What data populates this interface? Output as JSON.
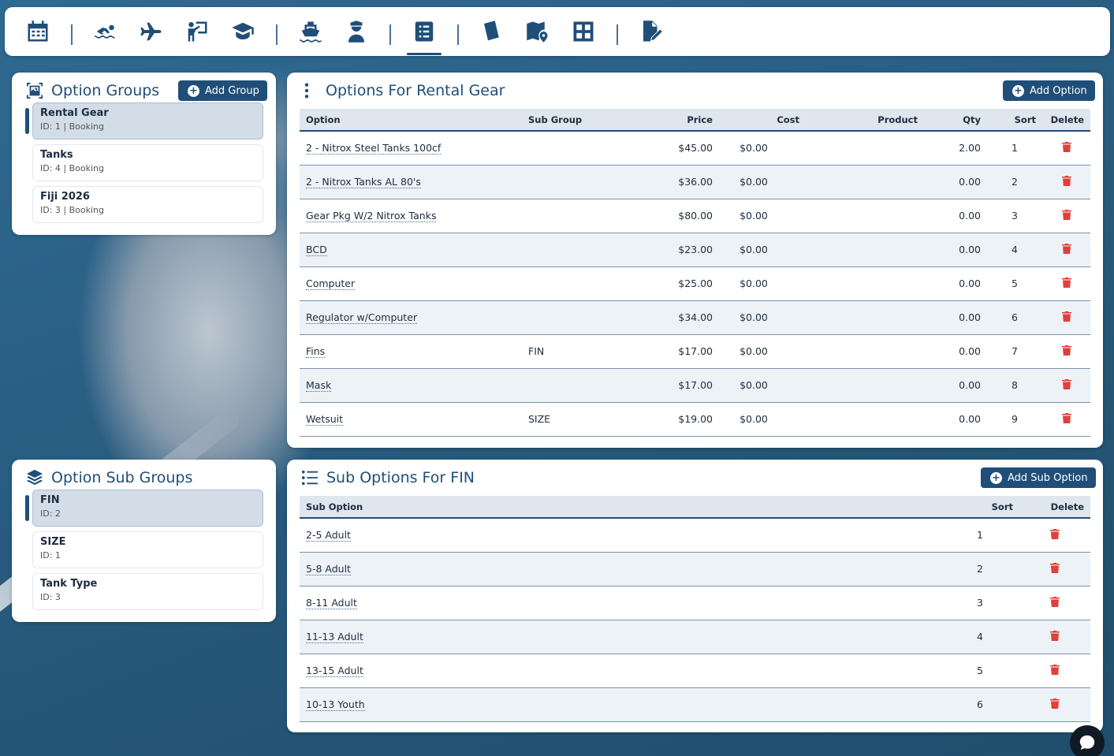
{
  "colors": {
    "accent": "#1f4e79",
    "delete": "#e0403a",
    "row_alt": "#edf2f7",
    "header_bg": "#dfe6ee"
  },
  "topnav": {
    "icons": [
      "calendar-icon",
      "swimmer-icon",
      "plane-icon",
      "instructor-icon",
      "graduation-cap-icon",
      "ship-icon",
      "captain-icon",
      "checklist-icon",
      "tablet-icon",
      "map-location-icon",
      "grid-icon",
      "file-signature-icon"
    ],
    "active": "checklist-icon"
  },
  "option_groups": {
    "title": "Option Groups",
    "add_label": "Add Group",
    "items": [
      {
        "name": "Rental Gear",
        "meta": "ID: 1 | Booking",
        "selected": true
      },
      {
        "name": "Tanks",
        "meta": "ID: 4 | Booking",
        "selected": false
      },
      {
        "name": "Fiji 2026",
        "meta": "ID: 3 | Booking",
        "selected": false
      }
    ]
  },
  "option_sub_groups": {
    "title": "Option Sub Groups",
    "items": [
      {
        "name": "FIN",
        "meta": "ID: 2",
        "selected": true
      },
      {
        "name": "SIZE",
        "meta": "ID: 1",
        "selected": false
      },
      {
        "name": "Tank Type",
        "meta": "ID: 3",
        "selected": false
      }
    ]
  },
  "options": {
    "title": "Options For Rental Gear",
    "add_label": "Add Option",
    "columns": [
      "Option",
      "Sub Group",
      "Price",
      "Cost",
      "Product",
      "Qty",
      "Sort",
      "Delete"
    ],
    "rows": [
      {
        "option": "2 - Nitrox Steel Tanks 100cf",
        "sub_group": "",
        "price": "$45.00",
        "cost": "$0.00",
        "product": "",
        "qty": "2.00",
        "sort": "1"
      },
      {
        "option": "2 - Nitrox Tanks AL 80's",
        "sub_group": "",
        "price": "$36.00",
        "cost": "$0.00",
        "product": "",
        "qty": "0.00",
        "sort": "2"
      },
      {
        "option": "Gear Pkg W/2 Nitrox Tanks",
        "sub_group": "",
        "price": "$80.00",
        "cost": "$0.00",
        "product": "",
        "qty": "0.00",
        "sort": "3"
      },
      {
        "option": "BCD",
        "sub_group": "",
        "price": "$23.00",
        "cost": "$0.00",
        "product": "",
        "qty": "0.00",
        "sort": "4"
      },
      {
        "option": "Computer",
        "sub_group": "",
        "price": "$25.00",
        "cost": "$0.00",
        "product": "",
        "qty": "0.00",
        "sort": "5"
      },
      {
        "option": "Regulator w/Computer",
        "sub_group": "",
        "price": "$34.00",
        "cost": "$0.00",
        "product": "",
        "qty": "0.00",
        "sort": "6"
      },
      {
        "option": "Fins",
        "sub_group": "FIN",
        "price": "$17.00",
        "cost": "$0.00",
        "product": "",
        "qty": "0.00",
        "sort": "7"
      },
      {
        "option": "Mask",
        "sub_group": "",
        "price": "$17.00",
        "cost": "$0.00",
        "product": "",
        "qty": "0.00",
        "sort": "8"
      },
      {
        "option": "Wetsuit",
        "sub_group": "SIZE",
        "price": "$19.00",
        "cost": "$0.00",
        "product": "",
        "qty": "0.00",
        "sort": "9"
      }
    ]
  },
  "sub_options": {
    "title": "Sub Options For FIN",
    "add_label": "Add Sub Option",
    "columns": [
      "Sub Option",
      "Sort",
      "Delete"
    ],
    "rows": [
      {
        "name": "2-5 Adult",
        "sort": "1"
      },
      {
        "name": "5-8 Adult",
        "sort": "2"
      },
      {
        "name": "8-11 Adult",
        "sort": "3"
      },
      {
        "name": "11-13 Adult",
        "sort": "4"
      },
      {
        "name": "13-15 Adult",
        "sort": "5"
      },
      {
        "name": "10-13 Youth",
        "sort": "6"
      }
    ]
  }
}
